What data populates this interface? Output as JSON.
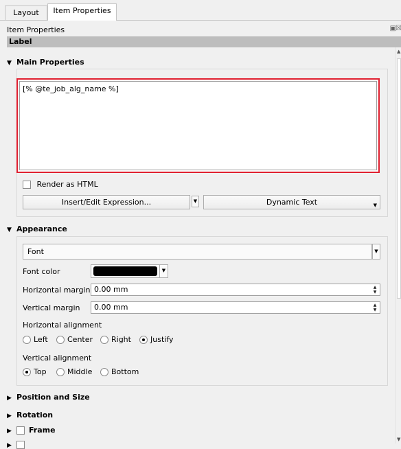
{
  "tabs": [
    {
      "label": "Layout",
      "active": false
    },
    {
      "label": "Item Properties",
      "active": true
    }
  ],
  "dock": {
    "title": "Item Properties"
  },
  "section": {
    "label": "Label"
  },
  "main_properties": {
    "title": "Main Properties",
    "text_value": "[% @te_job_alg_name %]",
    "render_html_label": "Render as HTML",
    "render_html_checked": false,
    "insert_expression_label": "Insert/Edit Expression...",
    "dynamic_text_label": "Dynamic Text"
  },
  "appearance": {
    "title": "Appearance",
    "font_label": "Font",
    "font_color_label": "Font color",
    "font_color": "#000000",
    "horizontal_margin_label": "Horizontal margin",
    "horizontal_margin_value": "0.00 mm",
    "vertical_margin_label": "Vertical margin",
    "vertical_margin_value": "0.00 mm",
    "horizontal_alignment_label": "Horizontal alignment",
    "h_options": [
      "Left",
      "Center",
      "Right",
      "Justify"
    ],
    "h_selected": "Justify",
    "vertical_alignment_label": "Vertical alignment",
    "v_options": [
      "Top",
      "Middle",
      "Bottom"
    ],
    "v_selected": "Top"
  },
  "collapsed_groups": {
    "position_size": "Position and Size",
    "rotation": "Rotation",
    "frame": "Frame"
  },
  "colors": {
    "highlight": "#e02030",
    "header_bg": "#bdbdbd"
  }
}
